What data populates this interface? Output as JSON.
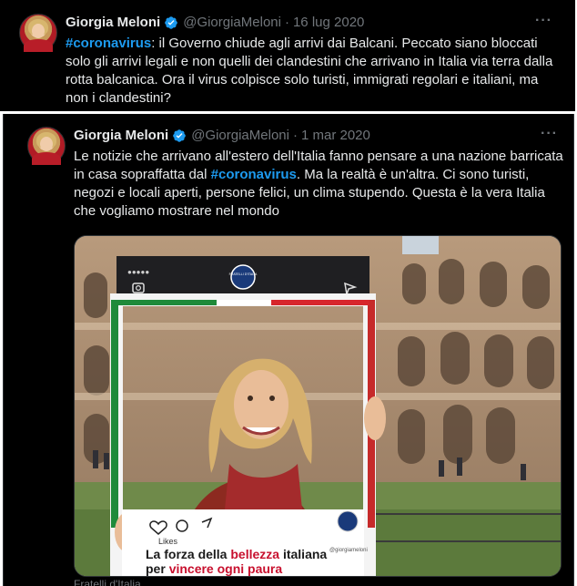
{
  "tweets": [
    {
      "author_name": "Giorgia Meloni",
      "handle": "@GiorgiaMeloni",
      "separator": "·",
      "date": "16 lug 2020",
      "more": "···",
      "hashtag": "#coronavirus",
      "text_after_hashtag": ": il Governo chiude agli arrivi dai Balcani. Peccato siano bloccati solo gli arrivi legali e non quelli dei clandestini che arrivano in Italia via terra dalla rotta balcanica. Ora il virus colpisce solo turisti, immigrati regolari e italiani, ma non i clandestini?"
    },
    {
      "author_name": "Giorgia Meloni",
      "handle": "@GiorgiaMeloni",
      "separator": "·",
      "date": "1 mar 2020",
      "more": "···",
      "text_before_hashtag": "Le notizie che arrivano all'estero dell'Italia fanno pensare a una nazione barricata in casa sopraffatta dal ",
      "hashtag": "#coronavirus",
      "text_after_hashtag": ". Ma la realtà è un'altra. Ci sono turisti, negozi e locali aperti, persone felici, un clima stupendo. Questa è la vera Italia che vogliamo mostrare nel mondo",
      "image": {
        "description_icon": "photo-frame",
        "frame_top_dots": "●●●●● ",
        "badge_text": "FRATELLI D'ITALIA",
        "likes_label": "Likes",
        "handle_caption": "@giorgiameloni",
        "slogan_1a": "La forza della ",
        "slogan_1b": "bellezza",
        "slogan_1c": " italiana",
        "slogan_2a": "per ",
        "slogan_2b": "vincere ogni paura"
      },
      "footer": "Fratelli d'Italia"
    }
  ],
  "colors": {
    "background": "#000000",
    "text": "#e7e9ea",
    "muted": "#71767b",
    "link": "#1d9bf0",
    "verified": "#1d9bf0"
  }
}
